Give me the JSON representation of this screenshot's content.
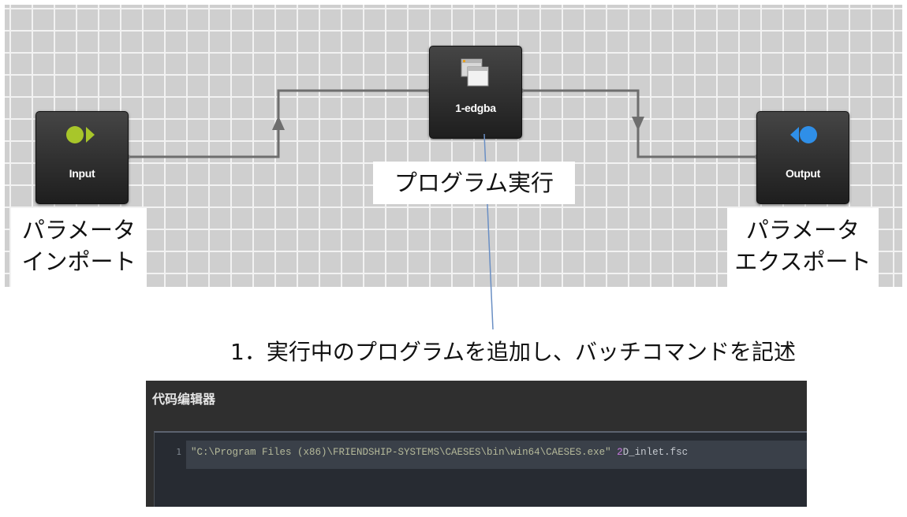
{
  "workflow": {
    "nodes": {
      "input": {
        "label": "Input",
        "icon": "input-arrow-icon"
      },
      "program": {
        "label": "1-edgba",
        "icon": "windows-stack-icon"
      },
      "output": {
        "label": "Output",
        "icon": "output-arrow-icon"
      }
    },
    "captions": {
      "param_import_line1": "パラメータ",
      "param_import_line2": "インポート",
      "program_exec": "プログラム実行",
      "param_export_line1": "パラメータ",
      "param_export_line2": "エクスポート"
    }
  },
  "step_label": "1．実行中のプログラムを追加し、バッチコマンドを記述",
  "editor": {
    "title": "代码编辑器",
    "line_number": "1",
    "code_string": "\"C:\\Program Files (x86)\\FRIENDSHIP-SYSTEMS\\CAESES\\bin\\win64\\CAESES.exe\"",
    "code_num": "2",
    "code_rest": "D_inlet.fsc"
  },
  "colors": {
    "input_icon": "#a8c62a",
    "output_icon": "#2f8fe8",
    "wire": "#6e6e6e",
    "callout_line": "#6a8fc4"
  }
}
